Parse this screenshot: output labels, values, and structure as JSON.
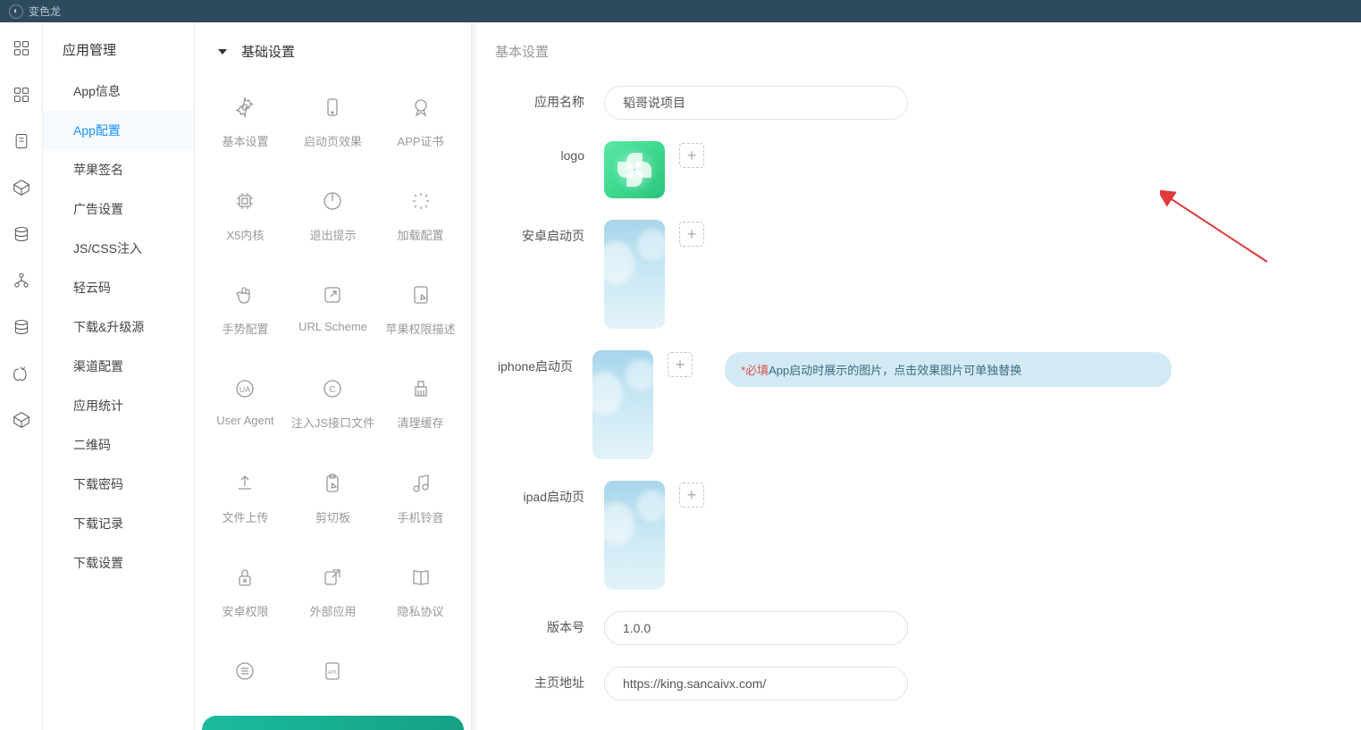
{
  "topBar": {
    "appName": "变色龙"
  },
  "sidebar": {
    "title": "应用管理",
    "items": [
      {
        "label": "App信息"
      },
      {
        "label": "App配置"
      },
      {
        "label": "苹果签名"
      },
      {
        "label": "广告设置"
      },
      {
        "label": "JS/CSS注入"
      },
      {
        "label": "轻云码"
      },
      {
        "label": "下载&升级源"
      },
      {
        "label": "渠道配置"
      },
      {
        "label": "应用统计"
      },
      {
        "label": "二维码"
      },
      {
        "label": "下载密码"
      },
      {
        "label": "下载记录"
      },
      {
        "label": "下载设置"
      }
    ]
  },
  "settings": {
    "header": "基础设置",
    "items": [
      {
        "label": "基本设置"
      },
      {
        "label": "启动页效果"
      },
      {
        "label": "APP证书"
      },
      {
        "label": "X5内核"
      },
      {
        "label": "退出提示"
      },
      {
        "label": "加载配置"
      },
      {
        "label": "手势配置"
      },
      {
        "label": "URL Scheme"
      },
      {
        "label": "苹果权限描述"
      },
      {
        "label": "User Agent"
      },
      {
        "label": "注入JS接口文件"
      },
      {
        "label": "清理缓存"
      },
      {
        "label": "文件上传"
      },
      {
        "label": "剪切板"
      },
      {
        "label": "手机铃音"
      },
      {
        "label": "安卓权限"
      },
      {
        "label": "外部应用"
      },
      {
        "label": "隐私协议"
      }
    ]
  },
  "main": {
    "title": "基本设置",
    "appNameLabel": "应用名称",
    "appNameValue": "韬哥说项目",
    "logoLabel": "logo",
    "androidSplashLabel": "安卓启动页",
    "iphoneSplashLabel": "iphone启动页",
    "ipadSplashLabel": "ipad启动页",
    "versionLabel": "版本号",
    "versionValue": "1.0.0",
    "homeUrlLabel": "主页地址",
    "homeUrlValue": "https://king.sancaivx.com/",
    "hint": {
      "required": "*必填",
      "text": " App启动时展示的图片，点击效果图片可单独替换"
    },
    "plus": "+"
  }
}
